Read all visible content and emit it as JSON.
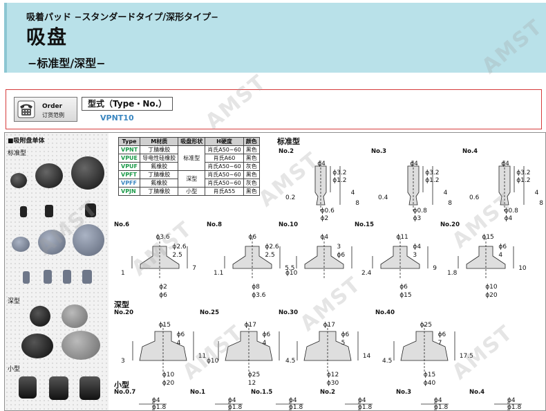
{
  "header": {
    "jp_line": "吸着パッド  −スタンダードタイプ/深形タイプ−",
    "title": "吸盘",
    "subtitle": "−标准型/深型−"
  },
  "order": {
    "icon": "phone-icon",
    "label_en": "Order",
    "label_cn": "订货范例",
    "type_label": "型式（Type・No.）",
    "example_code": "VPNT10"
  },
  "left_panel": {
    "title": "■吸附盘单体",
    "groups": [
      "标准型",
      "深型",
      "小型"
    ]
  },
  "watermark": "AMST",
  "spec_table": {
    "headers": [
      "Type",
      "M材质",
      "吸盘形状",
      "H硬度",
      "颜色"
    ],
    "rows": [
      {
        "type": "VPNT",
        "material": "丁腈橡胶",
        "shape": "",
        "hardness": "肖氏A50~60",
        "color": "黑色"
      },
      {
        "type": "VPUE",
        "material": "导电性硅橡胶",
        "shape": "标准型",
        "hardness": "肖氏A60",
        "color": "黑色"
      },
      {
        "type": "VPUF",
        "material": "氟橡胶",
        "shape": "",
        "hardness": "肖氏A50~60",
        "color": "灰色"
      },
      {
        "type": "VPFT",
        "material": "丁腈橡胶",
        "shape": "深型",
        "hardness": "肖氏A50~60",
        "color": "黑色"
      },
      {
        "type": "VPFF",
        "material": "氟橡胶",
        "shape": "",
        "hardness": "肖氏A50~60",
        "color": "灰色"
      },
      {
        "type": "VPJN",
        "material": "丁腈橡胶",
        "shape": "小型",
        "hardness": "肖氏A55",
        "color": "黑色"
      }
    ]
  },
  "sections": {
    "standard": "标准型",
    "deep": "深型",
    "small": "小型"
  },
  "drawings": {
    "standard_top": [
      {
        "no": "No.2",
        "dims": [
          "ϕ4",
          "ϕ3.2",
          "ϕ1.2",
          "0.2",
          "ϕ0.6",
          "ϕ2",
          "4",
          "8"
        ]
      },
      {
        "no": "No.3",
        "dims": [
          "ϕ4",
          "ϕ3.2",
          "ϕ1.2",
          "0.4",
          "ϕ0.8",
          "ϕ3",
          "4",
          "8"
        ]
      },
      {
        "no": "No.4",
        "dims": [
          "ϕ4",
          "ϕ3.2",
          "ϕ1.2",
          "0.6",
          "ϕ0.8",
          "ϕ4",
          "4",
          "8"
        ]
      }
    ],
    "standard_mid": [
      {
        "no": "No.6",
        "dims": [
          "ϕ3.6",
          "ϕ2.6",
          "2.5",
          "1",
          "ϕ2",
          "ϕ6",
          "7"
        ]
      },
      {
        "no": "No.8",
        "dims": [
          "ϕ6",
          "ϕ2.6",
          "2.5",
          "1.1",
          "ϕ8",
          "ϕ3.6",
          "5.5"
        ]
      },
      {
        "no": "No.10",
        "dims": [
          "ϕ4",
          "3",
          "ϕ6",
          "ϕ10"
        ]
      },
      {
        "no": "No.15",
        "dims": [
          "ϕ11",
          "ϕ4",
          "3",
          "2.4",
          "ϕ6",
          "ϕ15",
          "9"
        ]
      },
      {
        "no": "No.20",
        "dims": [
          "ϕ15",
          "ϕ6",
          "4",
          "1.8",
          "ϕ10",
          "ϕ20",
          "10"
        ]
      }
    ],
    "deep": [
      {
        "no": "No.20",
        "dims": [
          "ϕ15",
          "ϕ6",
          "4",
          "3",
          "ϕ10",
          "ϕ20",
          "11"
        ]
      },
      {
        "no": "No.25",
        "dims": [
          "ϕ17",
          "ϕ6",
          "4",
          "ϕ10",
          "ϕ25",
          "12"
        ]
      },
      {
        "no": "No.30",
        "dims": [
          "ϕ17",
          "ϕ6",
          "5",
          "4.5",
          "ϕ12",
          "ϕ30",
          "14"
        ]
      },
      {
        "no": "No.40",
        "dims": [
          "ϕ25",
          "ϕ6",
          "7",
          "4.5",
          "ϕ15",
          "ϕ40",
          "17.5"
        ]
      }
    ],
    "small": [
      {
        "no": "No.0.7",
        "dims": [
          "ϕ4",
          "ϕ1.8"
        ]
      },
      {
        "no": "No.1",
        "dims": [
          "ϕ4",
          "ϕ1.8"
        ]
      },
      {
        "no": "No.1.5",
        "dims": [
          "ϕ4",
          "ϕ1.8"
        ]
      },
      {
        "no": "No.2",
        "dims": [
          "ϕ4",
          "ϕ1.8"
        ]
      },
      {
        "no": "No.3",
        "dims": [
          "ϕ4",
          "ϕ1.8"
        ]
      },
      {
        "no": "No.4",
        "dims": [
          "ϕ4",
          "ϕ1.8"
        ]
      }
    ]
  }
}
